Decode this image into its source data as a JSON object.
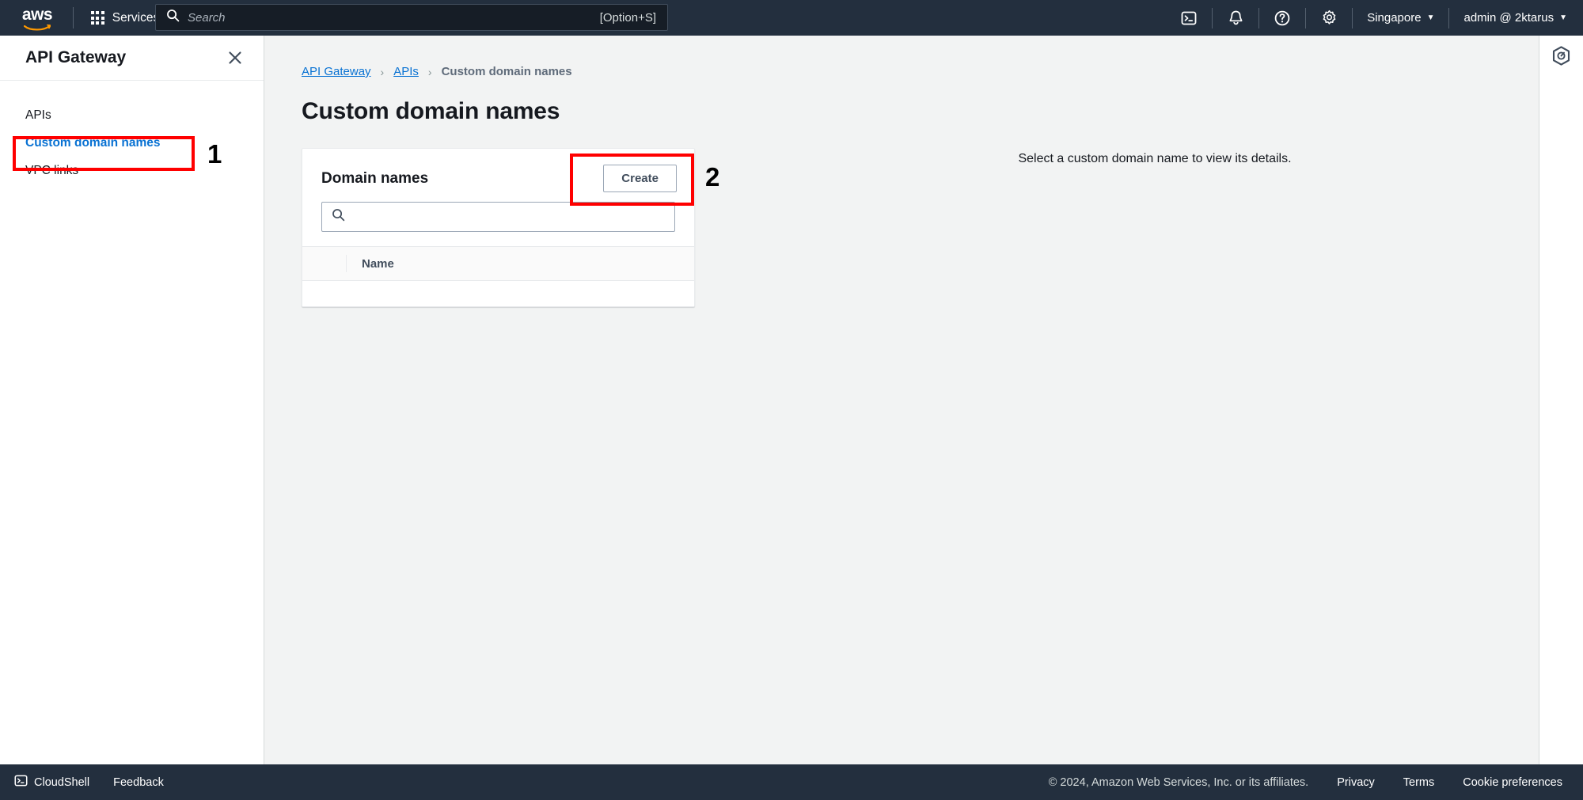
{
  "top_nav": {
    "logo_text": "aws",
    "logo_icon": "aws-logo",
    "services_label": "Services",
    "services_icon": "grid-menu-icon",
    "search": {
      "icon": "search-icon",
      "placeholder": "Search",
      "value": "",
      "shortcut": "[Option+S]"
    },
    "icons": [
      {
        "name": "cloudshell-icon",
        "glyph": "cloudshell"
      },
      {
        "name": "notifications-bell-icon",
        "glyph": "bell"
      },
      {
        "name": "help-question-icon",
        "glyph": "question"
      },
      {
        "name": "settings-gear-icon",
        "glyph": "gear"
      }
    ],
    "region": "Singapore",
    "account": "admin @ 2ktarus",
    "caret": "▼"
  },
  "sidebar": {
    "title": "API Gateway",
    "close_icon": "close-x-icon",
    "items": [
      {
        "label": "APIs",
        "active": false
      },
      {
        "label": "Custom domain names",
        "active": true
      },
      {
        "label": "VPC links",
        "active": false
      }
    ]
  },
  "breadcrumb": {
    "items": [
      {
        "label": "API Gateway",
        "link": true
      },
      {
        "label": "APIs",
        "link": true
      },
      {
        "label": "Custom domain names",
        "link": false
      }
    ],
    "separator": "›"
  },
  "page": {
    "title": "Custom domain names"
  },
  "card": {
    "title": "Domain names",
    "create_label": "Create",
    "search": {
      "icon": "search-icon",
      "value": "",
      "placeholder": ""
    },
    "table": {
      "columns": [
        "Name"
      ],
      "rows": []
    }
  },
  "detail_pane": {
    "empty_message": "Select a custom domain name to view its details."
  },
  "right_rail": {
    "icon": "help-panel-hexagon-icon"
  },
  "footer": {
    "cloudshell_label": "CloudShell",
    "cloudshell_icon": "cloudshell-icon",
    "feedback_label": "Feedback",
    "copyright": "© 2024, Amazon Web Services, Inc. or its affiliates.",
    "links": [
      "Privacy",
      "Terms",
      "Cookie preferences"
    ]
  },
  "annotations": {
    "markers": [
      {
        "number": "1",
        "target": "sidebar-item-custom-domain-names"
      },
      {
        "number": "2",
        "target": "create-button"
      }
    ],
    "box_color": "#ff0000"
  }
}
